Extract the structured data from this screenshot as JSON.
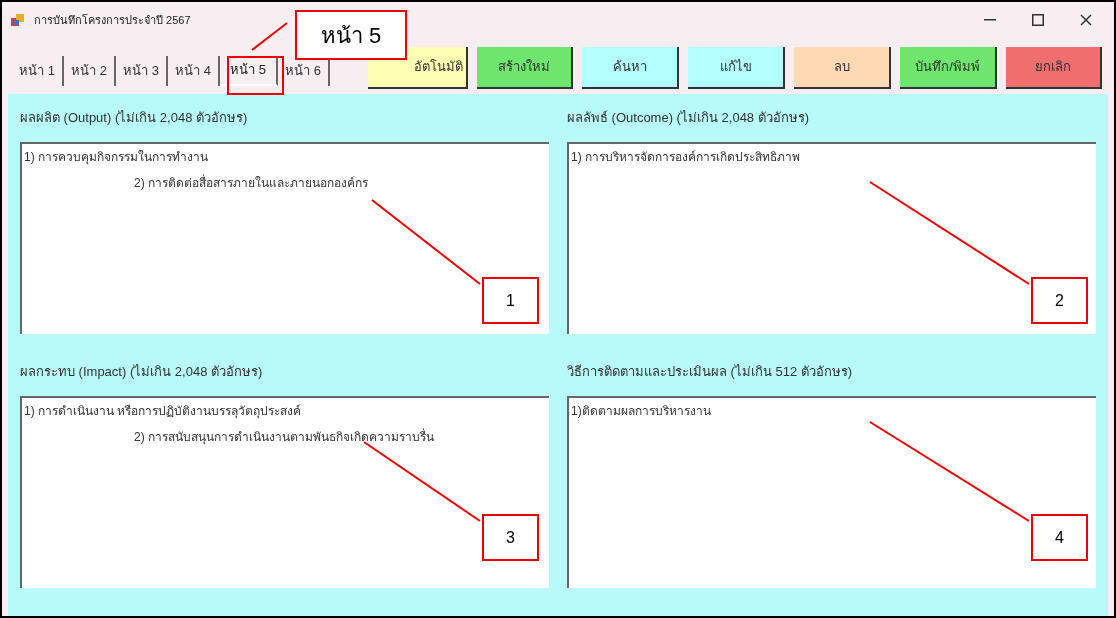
{
  "window": {
    "title": "การบันทึกโครงการประจำปี 2567"
  },
  "tabs": [
    {
      "label": "หน้า 1",
      "selected": false
    },
    {
      "label": "หน้า 2",
      "selected": false
    },
    {
      "label": "หน้า 3",
      "selected": false
    },
    {
      "label": "หน้า 4",
      "selected": false
    },
    {
      "label": "หน้า 5",
      "selected": true
    },
    {
      "label": "หน้า 6",
      "selected": false
    }
  ],
  "buttons": [
    {
      "label": "อัตโนมัติ",
      "color": "#ffffb4"
    },
    {
      "label": "สร้างใหม่",
      "color": "#6ee66e"
    },
    {
      "label": "ค้นหา",
      "color": "#b4ffff"
    },
    {
      "label": "แก้ไข",
      "color": "#b4ffff"
    },
    {
      "label": "ลบ",
      "color": "#ffd8b4"
    },
    {
      "label": "บันทึก/พิมพ์",
      "color": "#6ee66e"
    },
    {
      "label": "ยกเลิก",
      "color": "#f06e6e"
    }
  ],
  "sections": [
    {
      "label": "ผลผลิต (Output) (ไม่เกิน 2,048 ตัวอักษร)",
      "lines": [
        {
          "text": "1) การควบคุมกิจกรรมในการทำงาน",
          "indented": false
        },
        {
          "text": "2) การติดต่อสื่อสารภายในและภายนอกองค์กร",
          "indented": true
        }
      ],
      "callout": "1"
    },
    {
      "label": "ผลลัพธ์ (Outcome) (ไม่เกิน 2,048 ตัวอักษร)",
      "lines": [
        {
          "text": "1) การบริหารจัดการองค์การเกิดประสิทธิภาพ",
          "indented": false
        }
      ],
      "callout": "2"
    },
    {
      "label": "ผลกระทบ (Impact) (ไม่เกิน 2,048 ตัวอักษร)",
      "lines": [
        {
          "text": "1) การดำเนินงาน หรือการปฏิบัติงานบรรลุวัตถุประสงค์",
          "indented": false
        },
        {
          "text": "2) การสนับสนุนการดำเนินงานตามพันธกิจเกิดความราบรื่น",
          "indented": true
        }
      ],
      "callout": "3"
    },
    {
      "label": "วิธีการติดตามและประเมินผล (ไม่เกิน 512 ตัวอักษร)",
      "lines": [
        {
          "text": "1)ติดตามผลการบริหารงาน",
          "indented": false
        }
      ],
      "callout": "4"
    }
  ],
  "tab_callout": "หน้า 5"
}
